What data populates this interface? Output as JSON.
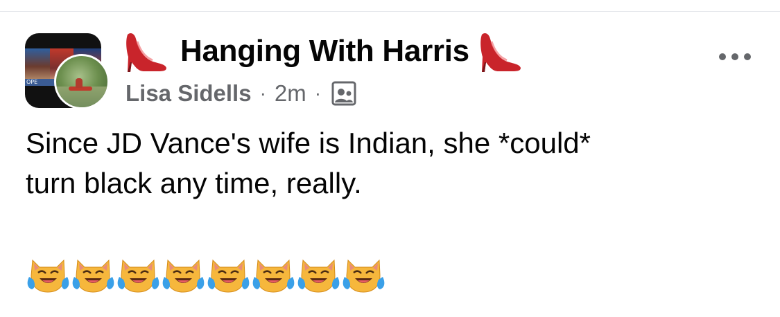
{
  "post": {
    "group_title": "Hanging With Harris",
    "title_icons": [
      "high-heel-icon",
      "high-heel-icon"
    ],
    "author": "Lisa Sidells",
    "separator": "·",
    "time": "2m",
    "audience_icon": "group-audience-icon",
    "more_icon": "more-options-icon",
    "text_line_1": "Since JD Vance's wife is Indian, she *could*",
    "text_line_2": "turn black any time, really.",
    "emoji": [
      "😹",
      "😹",
      "😹",
      "😹",
      "😹",
      "😹",
      "😹",
      "😹"
    ],
    "group_avatar_caption": "OPE"
  },
  "colors": {
    "text_primary": "#050505",
    "text_secondary": "#65676b",
    "heel_red": "#c9242b",
    "divider": "#e4e6eb"
  }
}
